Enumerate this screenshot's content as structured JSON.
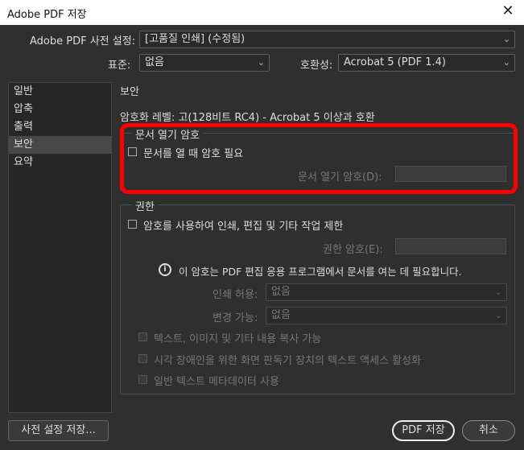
{
  "window": {
    "title": "Adobe PDF 저장",
    "close_glyph": "✕"
  },
  "header": {
    "preset_label": "Adobe PDF 사전 설정:",
    "preset_value": "[고품질 인쇄] (수정됨)",
    "standard_label": "표준:",
    "standard_value": "없음",
    "compat_label": "호환성:",
    "compat_value": "Acrobat 5 (PDF 1.4)"
  },
  "sidebar": {
    "items": [
      {
        "label": "일반"
      },
      {
        "label": "압축"
      },
      {
        "label": "출력"
      },
      {
        "label": "보안"
      },
      {
        "label": "요약"
      }
    ],
    "active_index": 3
  },
  "main": {
    "section_title": "보안",
    "encryption_text": "암호화 레벨: 고(128비트 RC4) - Acrobat 5 이상과 호환",
    "open_password": {
      "group_title": "문서 열기 암호",
      "checkbox_label": "문서를 열 때 암호 필요",
      "checked": false,
      "field_label": "문서 열기 암호(D):",
      "field_value": ""
    },
    "permissions": {
      "group_title": "권한",
      "checkbox_label": "암호를 사용하여 인쇄, 편집 및 기타 작업 제한",
      "checked": false,
      "password_label": "권한 암호(E):",
      "password_value": "",
      "info_text": "이 암호는 PDF 편집 응용 프로그램에서 문서를 여는 데 필요합니다.",
      "print_label": "인쇄 허용:",
      "print_value": "없음",
      "change_label": "변경 가능:",
      "change_value": "없음",
      "copy_label": "텍스트, 이미지 및 기타 내용 복사 가능",
      "screenreader_label": "시각 장애인을 위한 화면 판독기 장치의 텍스트 액세스 활성화",
      "metadata_label": "일반 텍스트 메타데이터 사용"
    }
  },
  "footer": {
    "save_preset_label": "사전 설정 저장...",
    "save_pdf_label": "PDF 저장",
    "cancel_label": "취소"
  },
  "icons": {
    "chevron": "⌄",
    "info": "i"
  },
  "colors": {
    "highlight": "#ff0000",
    "background": "#2f2f2f"
  }
}
